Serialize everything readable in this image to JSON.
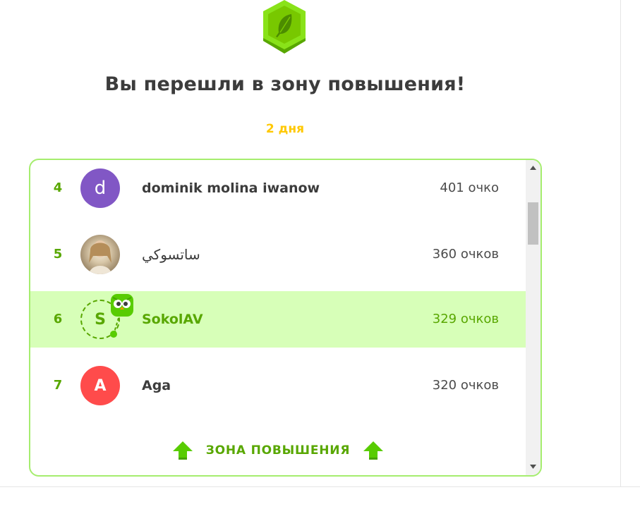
{
  "header": {
    "badge_icon": "feather-league-badge-icon",
    "title": "Вы перешли в зону повышения!",
    "days_left": "2 дня"
  },
  "leaderboard": {
    "rows": [
      {
        "rank": "4",
        "avatar_letter": "d",
        "name": "dominik molina iwanow",
        "points": "401 очко",
        "current": false
      },
      {
        "rank": "5",
        "avatar_letter": "",
        "name": "ساتسوكي",
        "points": "360 очков",
        "current": false
      },
      {
        "rank": "6",
        "avatar_letter": "S",
        "name": "SokolAV",
        "points": "329 очков",
        "current": true
      },
      {
        "rank": "7",
        "avatar_letter": "A",
        "name": "Aga",
        "points": "320 очков",
        "current": false
      }
    ],
    "promotion_zone_label": "ЗОНА ПОВЫШЕНИЯ",
    "promotion_icon": "up-arrow-icon"
  },
  "colors": {
    "accent_green": "#58a700",
    "highlight_row": "#d7ffb8",
    "board_border": "#a5ed6e",
    "days_color": "#ffc800",
    "avatar_purple": "#8157c5",
    "avatar_red": "#ff4b4b"
  }
}
